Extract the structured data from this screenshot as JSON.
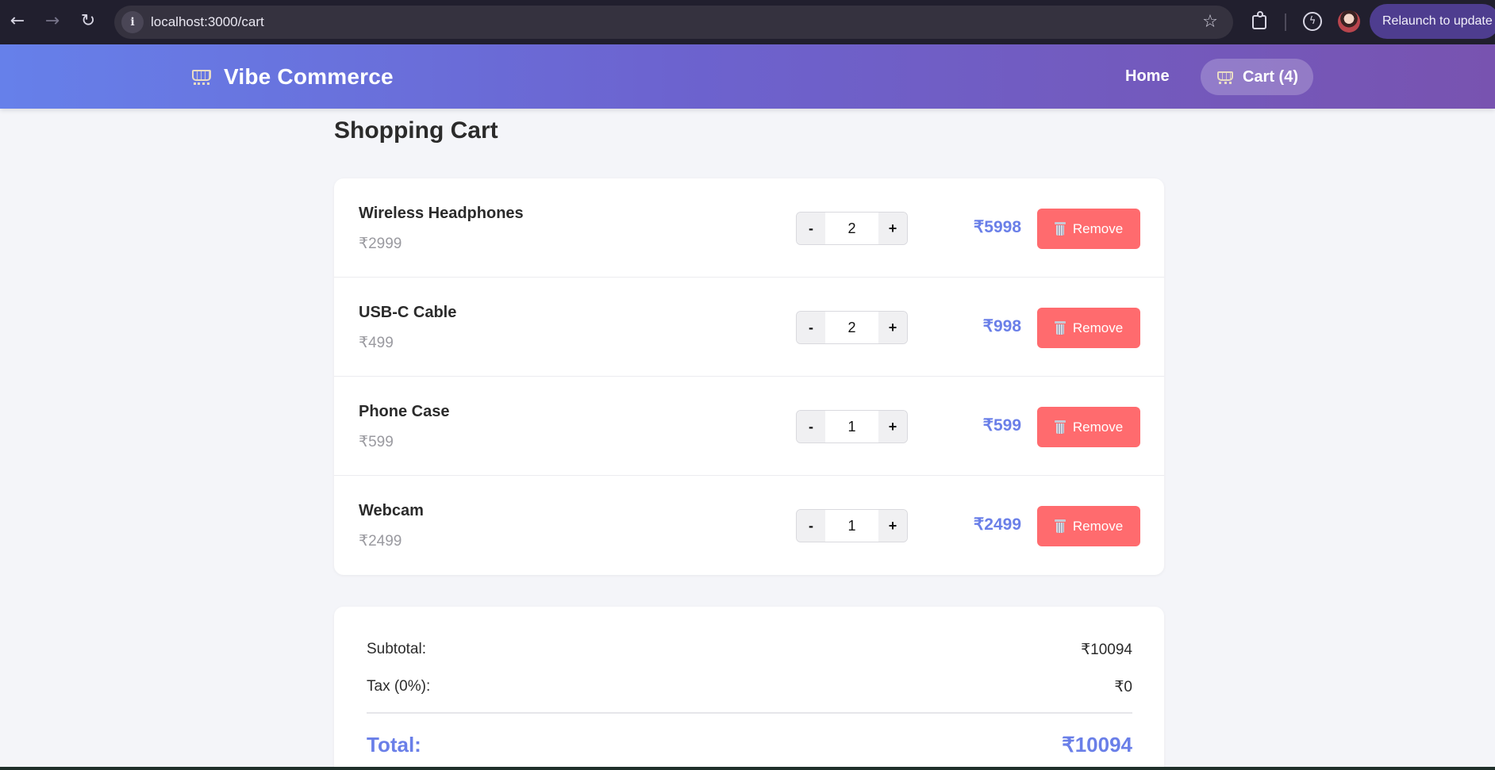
{
  "browser": {
    "url": "localhost:3000/cart",
    "relaunch_label": "Relaunch to update"
  },
  "header": {
    "brand": "Vibe Commerce",
    "nav_home": "Home",
    "nav_cart": "Cart (4)"
  },
  "page": {
    "title": "Shopping Cart"
  },
  "cart": {
    "remove_label": "Remove",
    "minus_label": "-",
    "plus_label": "+",
    "items": [
      {
        "name": "Wireless Headphones",
        "unit_price": "₹2999",
        "quantity": "2",
        "line_total": "₹5998"
      },
      {
        "name": "USB-C Cable",
        "unit_price": "₹499",
        "quantity": "2",
        "line_total": "₹998"
      },
      {
        "name": "Phone Case",
        "unit_price": "₹599",
        "quantity": "1",
        "line_total": "₹599"
      },
      {
        "name": "Webcam",
        "unit_price": "₹2499",
        "quantity": "1",
        "line_total": "₹2499"
      }
    ]
  },
  "summary": {
    "subtotal_label": "Subtotal:",
    "subtotal_value": "₹10094",
    "tax_label": "Tax (0%):",
    "tax_value": "₹0",
    "total_label": "Total:",
    "total_value": "₹10094"
  },
  "colors": {
    "header_gradient_start": "#6680ea",
    "header_gradient_end": "#7853b0",
    "accent": "#6a7fe8",
    "remove_button": "#ff6b6e"
  },
  "icons": [
    "back-arrow-icon",
    "forward-arrow-icon",
    "reload-icon",
    "site-info-icon",
    "bookmark-star-icon",
    "extensions-icon",
    "performance-icon",
    "profile-avatar",
    "shopping-cart-icon",
    "trash-icon"
  ]
}
